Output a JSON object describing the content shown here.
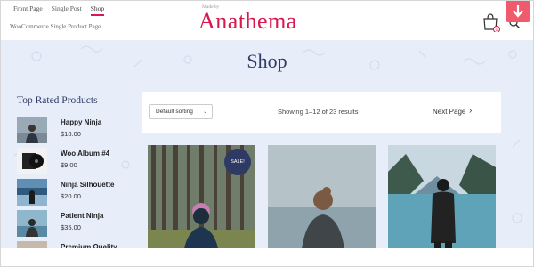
{
  "header": {
    "nav": [
      "Front Page",
      "Single Post",
      "Shop"
    ],
    "active_nav": "Shop",
    "subnav": "WooCommerce Single Product Page",
    "made_by": "Made by",
    "logo": "Anathema",
    "cart_count": "0"
  },
  "main": {
    "title": "Shop",
    "sidebar_title": "Top Rated Products",
    "products": [
      {
        "name": "Happy Ninja",
        "price": "$18.00"
      },
      {
        "name": "Woo Album #4",
        "price": "$9.00"
      },
      {
        "name": "Ninja Silhouette",
        "price": "$20.00"
      },
      {
        "name": "Patient Ninja",
        "price": "$35.00"
      },
      {
        "name": "Premium Quality",
        "price": ""
      }
    ],
    "toolbar": {
      "sort_label": "Default sorting",
      "results_text": "Showing 1–12 of 23 results",
      "next_label": "Next Page"
    },
    "sale_badge": "SALE!"
  },
  "colors": {
    "accent": "#d8194f",
    "navy": "#2e3a64",
    "background": "#e7edf9",
    "red_tab": "#ef5a6c"
  },
  "icons": [
    "cart-icon",
    "search-icon",
    "download-arrow-icon",
    "chevron-right-icon",
    "chevron-down-icon"
  ]
}
